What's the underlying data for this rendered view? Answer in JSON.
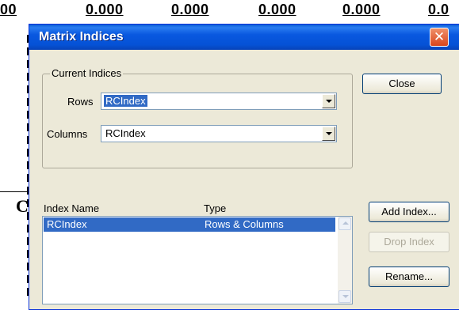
{
  "background": {
    "cells": [
      "0.000",
      "0.000",
      "0.000",
      "0.000",
      "0.000"
    ],
    "edge_left": "00",
    "edge_right": "0.0",
    "letter": "C"
  },
  "dialog": {
    "title": "Matrix Indices",
    "close_glyph": "✕"
  },
  "current_indices": {
    "group_label": "Current Indices",
    "rows_label": "Rows",
    "rows_value": "RCIndex",
    "columns_label": "Columns",
    "columns_value": "RCIndex"
  },
  "index_list": {
    "columns": [
      "Index Name",
      "Type"
    ],
    "rows": [
      {
        "name": "RCIndex",
        "type": "Rows & Columns",
        "selected": true
      }
    ]
  },
  "buttons": {
    "close": "Close",
    "add_index": "Add Index...",
    "drop_index": "Drop Index",
    "rename": "Rename..."
  },
  "colors": {
    "titlebar": "#0a5fd6",
    "selection": "#316ac5",
    "dialog_bg": "#ece9d8"
  }
}
